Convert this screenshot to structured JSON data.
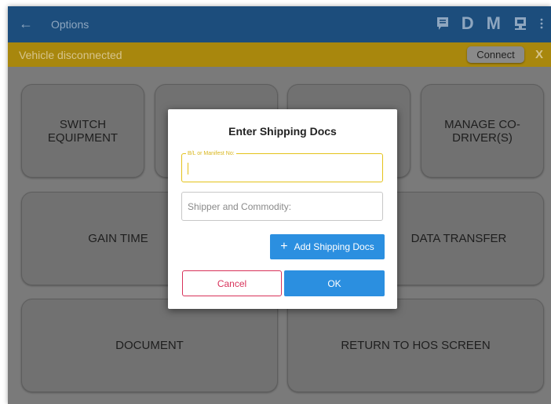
{
  "appbar": {
    "back_icon": "arrow-left-icon",
    "title": "Options",
    "actions": [
      {
        "type": "icon",
        "icon": "message-icon"
      },
      {
        "type": "letter",
        "label": "D"
      },
      {
        "type": "letter",
        "label": "M"
      },
      {
        "type": "icon",
        "icon": "monitor-icon"
      },
      {
        "type": "icon",
        "icon": "overflow-menu-icon"
      }
    ]
  },
  "banner": {
    "message": "Vehicle disconnected",
    "connect_label": "Connect",
    "close_label": "X"
  },
  "tiles": {
    "switch_equipment": "SWITCH EQUIPMENT",
    "manage_co_driver": "MANAGE CO-DRIVER(S)",
    "gain_time": "GAIN TIME",
    "data_transfer": "DATA TRANSFER",
    "document": "DOCUMENT",
    "return_to_hos": "RETURN TO HOS SCREEN"
  },
  "dialog": {
    "title": "Enter Shipping Docs",
    "bl_field": {
      "label": "B/L or Manifest No:",
      "value": ""
    },
    "shipper_field": {
      "placeholder": "Shipper and Commodity:",
      "value": ""
    },
    "add_button": {
      "icon": "plus-icon",
      "label": "Add Shipping Docs"
    },
    "cancel_label": "Cancel",
    "ok_label": "OK"
  },
  "colors": {
    "appbar": "#1c4d7c",
    "banner": "#a8870d",
    "primary_button": "#2b8fe0",
    "cancel_accent": "#d8325a",
    "field_focus": "#e4c21a"
  }
}
